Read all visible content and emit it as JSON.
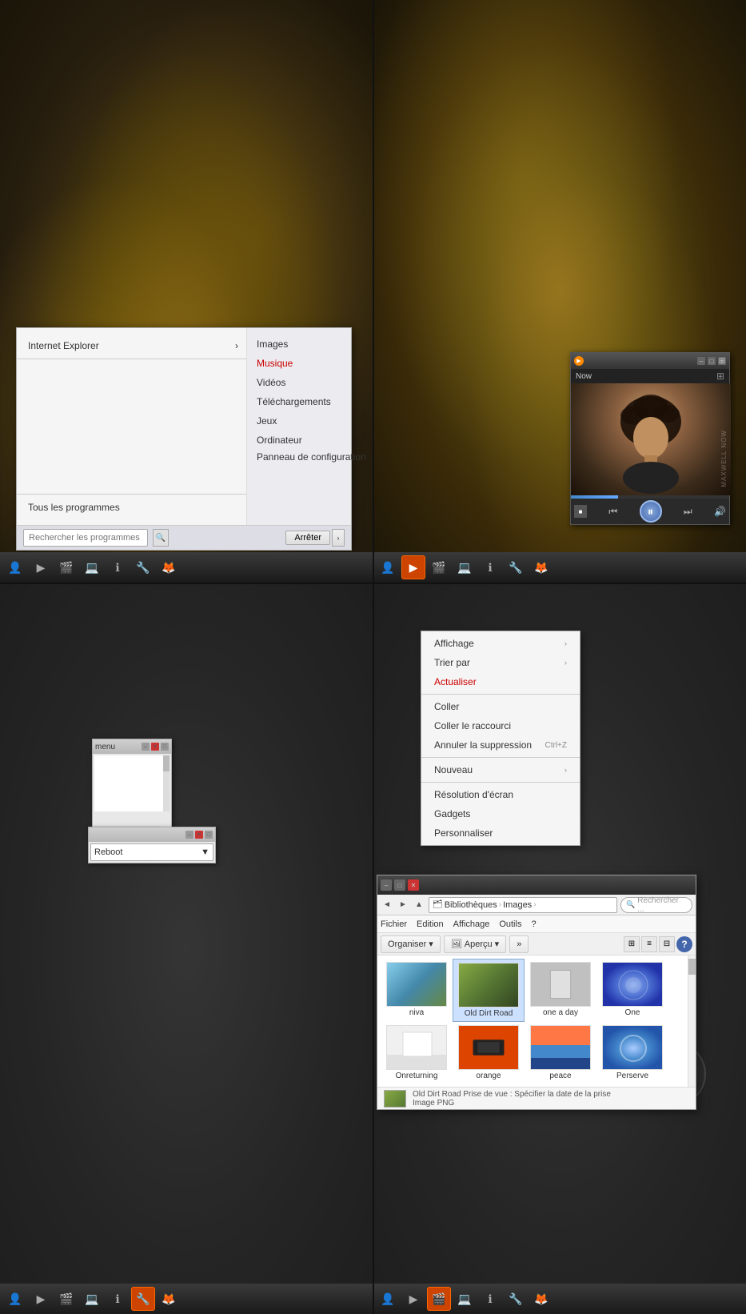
{
  "topLeft": {
    "startMenu": {
      "pinnedItem": "Internet Explorer",
      "rightItems": [
        "Images",
        "Musique",
        "Vidéos",
        "Téléchargements",
        "Jeux",
        "Ordinateur",
        "Panneau de configuration"
      ],
      "allPrograms": "Tous les programmes",
      "searchPlaceholder": "Rechercher les programmes et fichiers",
      "shutdownBtn": "Arrêter"
    },
    "taskbar": {
      "icons": [
        "👤",
        "▶",
        "🎬",
        "💻",
        "ℹ",
        "🔧",
        "🦊"
      ]
    }
  },
  "topRight": {
    "mediaPlayer": {
      "title": "Now",
      "watermark": "MAXWELL NOW",
      "playState": "paused",
      "progressPct": 30
    },
    "taskbar": {
      "icons": [
        "👤",
        "▶",
        "🎬",
        "💻",
        "ℹ",
        "🔧",
        "🦊"
      ]
    }
  },
  "bottomLeft": {
    "widgetWindow": {
      "title": "menu"
    },
    "dropdownWindow": {
      "value": "Reboot"
    },
    "taskbar": {
      "icons": [
        "👤",
        "▶",
        "🎬",
        "💻",
        "ℹ",
        "🔧",
        "🦊"
      ]
    }
  },
  "bottomRight": {
    "contextMenu": {
      "items": [
        {
          "label": "Affichage",
          "hasSubmenu": true
        },
        {
          "label": "Trier par",
          "hasSubmenu": true
        },
        {
          "label": "Actualiser",
          "active": true
        },
        {
          "label": "Coller"
        },
        {
          "label": "Coller le raccourci"
        },
        {
          "label": "Annuler la suppression",
          "shortcut": "Ctrl+Z"
        },
        {
          "label": "Nouveau",
          "hasSubmenu": true
        },
        {
          "label": "Résolution d'écran"
        },
        {
          "label": "Gadgets"
        },
        {
          "label": "Personnaliser"
        }
      ]
    },
    "fileExplorer": {
      "breadcrumb": [
        "Bibliothèques",
        "Images"
      ],
      "searchPlaceholder": "Rechercher ...",
      "menuItems": [
        "Fichier",
        "Edition",
        "Affichage",
        "Outils",
        "?"
      ],
      "toolbarItems": [
        "Organiser",
        "Aperçu"
      ],
      "files": [
        {
          "name": "niva",
          "thumbClass": "thumb-niva"
        },
        {
          "name": "Old Dirt Road",
          "thumbClass": "thumb-oldroad",
          "selected": true
        },
        {
          "name": "one a day",
          "thumbClass": "thumb-oneaday"
        },
        {
          "name": "One",
          "thumbClass": "thumb-one"
        },
        {
          "name": "Onreturning",
          "thumbClass": "thumb-onreturning"
        },
        {
          "name": "orange",
          "thumbClass": "thumb-orange"
        },
        {
          "name": "peace",
          "thumbClass": "thumb-peace"
        },
        {
          "name": "Perserve",
          "thumbClass": "thumb-perserve"
        }
      ],
      "statusText": "Old Dirt Road  Prise de vue : Spécifier la date de la prise",
      "statusType": "Image PNG"
    },
    "taskbar": {
      "icons": [
        "👤",
        "▶",
        "🎬",
        "💻",
        "ℹ",
        "🔧",
        "🦊"
      ]
    }
  }
}
